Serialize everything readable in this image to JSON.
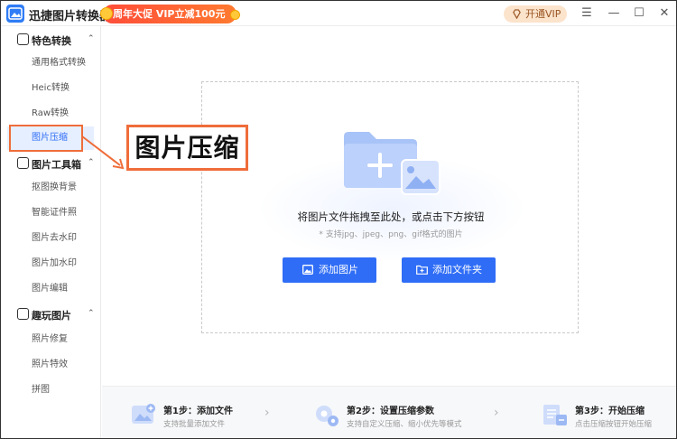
{
  "app": {
    "title": "迅捷图片转换器",
    "promo": "周年大促 VIP立减100元",
    "vip_button": "开通VIP",
    "controls": {
      "menu": "☰",
      "minimize": "—",
      "maximize": "☐",
      "close": "✕"
    }
  },
  "sidebar": {
    "groups": [
      {
        "label": "特色转换",
        "items": [
          "通用格式转换",
          "Heic转换",
          "Raw转换",
          "图片压缩"
        ]
      },
      {
        "label": "图片工具箱",
        "items": [
          "抠图换背景",
          "智能证件照",
          "图片去水印",
          "图片加水印",
          "图片编辑"
        ]
      },
      {
        "label": "趣玩图片",
        "items": [
          "照片修复",
          "照片特效",
          "拼图"
        ]
      }
    ],
    "active_item": "图片压缩"
  },
  "annotation": {
    "label": "图片压缩"
  },
  "dropzone": {
    "title": "将图片文件拖拽至此处，或点击下方按钮",
    "subtitle": "* 支持jpg、jpeg、png、gif格式的图片",
    "add_image": "添加图片",
    "add_folder": "添加文件夹"
  },
  "steps": [
    {
      "title": "第1步：添加文件",
      "desc": "支持批量添加文件"
    },
    {
      "title": "第2步：设置压缩参数",
      "desc": "支持自定义压缩、缩小优先等模式"
    },
    {
      "title": "第3步：开始压缩",
      "desc": "点击压缩按钮开始压缩"
    }
  ],
  "colors": {
    "accent": "#2f6df6",
    "annotation": "#ef6d3a",
    "promo": "#ff4d3a"
  }
}
